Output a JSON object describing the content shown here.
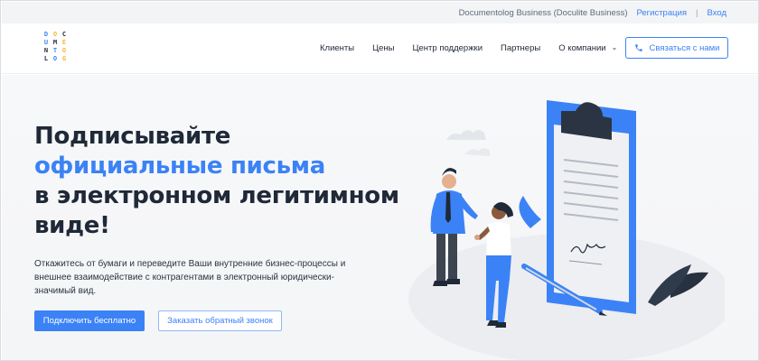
{
  "topbar": {
    "business": "Documentolog Business (Doculite Business)",
    "register": "Регистрация",
    "separator": "|",
    "login": "Вход"
  },
  "logo": {
    "letters": [
      "D",
      "O",
      "C",
      "U",
      "M",
      "E",
      "N",
      "T",
      "O",
      "L",
      "O",
      "G"
    ],
    "colors": [
      "#3b82f6",
      "#f5b731",
      "#1f2937",
      "#3b82f6"
    ]
  },
  "nav": {
    "items": [
      "Клиенты",
      "Цены",
      "Центр поддержки",
      "Партнеры",
      "О компании"
    ],
    "contact_button": "Связаться с нами"
  },
  "hero": {
    "headline_line1": "Подписывайте",
    "headline_line2": "официальные письма",
    "headline_line3": "в электронном легитимном",
    "headline_line4": "виде!",
    "description": "Откажитесь от бумаги и переведите Ваши внутренние бизнес-процессы и внешнее взаимодействие с контрагентами в электронный юридически-значимый вид.",
    "primary_button": "Подключить бесплатно",
    "secondary_button": "Заказать обратный звонок"
  },
  "colors": {
    "accent": "#3b82f6",
    "text": "#1f2937",
    "hero_bg": "#f5f6f8"
  },
  "icons": {
    "phone": "phone-icon",
    "dropdown": "chevron-down-icon"
  }
}
